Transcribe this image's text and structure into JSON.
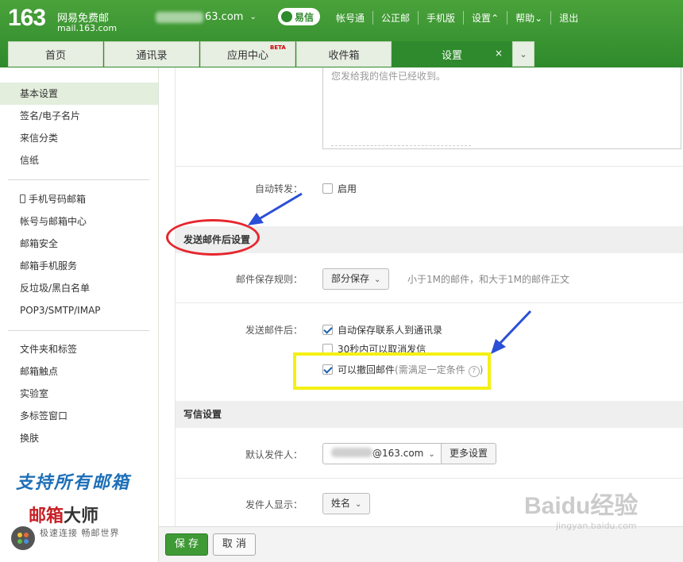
{
  "header": {
    "logo_number": "163",
    "logo_name": "网易免费邮",
    "logo_domain": "mail.163.com",
    "account_suffix": "63.com",
    "yixin_label": "易信",
    "top_links": [
      "帐号通",
      "公正邮",
      "手机版",
      "设置",
      "帮助",
      "退出"
    ]
  },
  "tabs": [
    {
      "label": "首页"
    },
    {
      "label": "通讯录"
    },
    {
      "label": "应用中心",
      "badge": "BETA"
    },
    {
      "label": "收件箱"
    },
    {
      "label": "设置",
      "close": "×"
    }
  ],
  "sidebar": {
    "group1": [
      "基本设置",
      "签名/电子名片",
      "来信分类",
      "信纸"
    ],
    "group2": [
      "手机号码邮箱",
      "帐号与邮箱中心",
      "邮箱安全",
      "邮箱手机服务",
      "反垃圾/黑白名单",
      "POP3/SMTP/IMAP"
    ],
    "group3": [
      "文件夹和标签",
      "邮箱触点",
      "实验室",
      "多标签窗口",
      "换肤"
    ],
    "promo_line1": "支持所有邮箱",
    "promo_brand_red": "邮箱",
    "promo_brand_dark": "大师",
    "promo_line3": "极速连接  畅邮世界"
  },
  "main": {
    "reply_text": "您发给我的信件已经收到。",
    "auto_forward_label": "自动转发：",
    "auto_forward_option": "启用",
    "after_send_title": "发送邮件后设置",
    "save_rule_label": "邮件保存规则：",
    "save_rule_value": "部分保存",
    "save_rule_hint": "小于1M的邮件，和大于1M的邮件正文",
    "after_send_label": "发送邮件后：",
    "opt_save_contacts": "自动保存联系人到通讯录",
    "opt_cancel_30s": "30秒内可以取消发信",
    "opt_recall": "可以撤回邮件",
    "opt_recall_note": "(需满足一定条件",
    "opt_recall_note_end": ")",
    "compose_title": "写信设置",
    "default_sender_label": "默认发件人：",
    "default_sender_value": "@163.com",
    "more_settings": "更多设置",
    "sender_display_label": "发件人显示：",
    "sender_display_value": "姓名"
  },
  "footer": {
    "save": "保 存",
    "cancel": "取 消"
  },
  "watermark": {
    "top": "Baidu经验",
    "bottom": "jingyan.baidu.com"
  },
  "colors": {
    "brand_green": "#2e8a2c",
    "annotation_red": "#e6262d",
    "annotation_yellow": "#f4f014",
    "arrow_blue": "#2b4fd6"
  }
}
